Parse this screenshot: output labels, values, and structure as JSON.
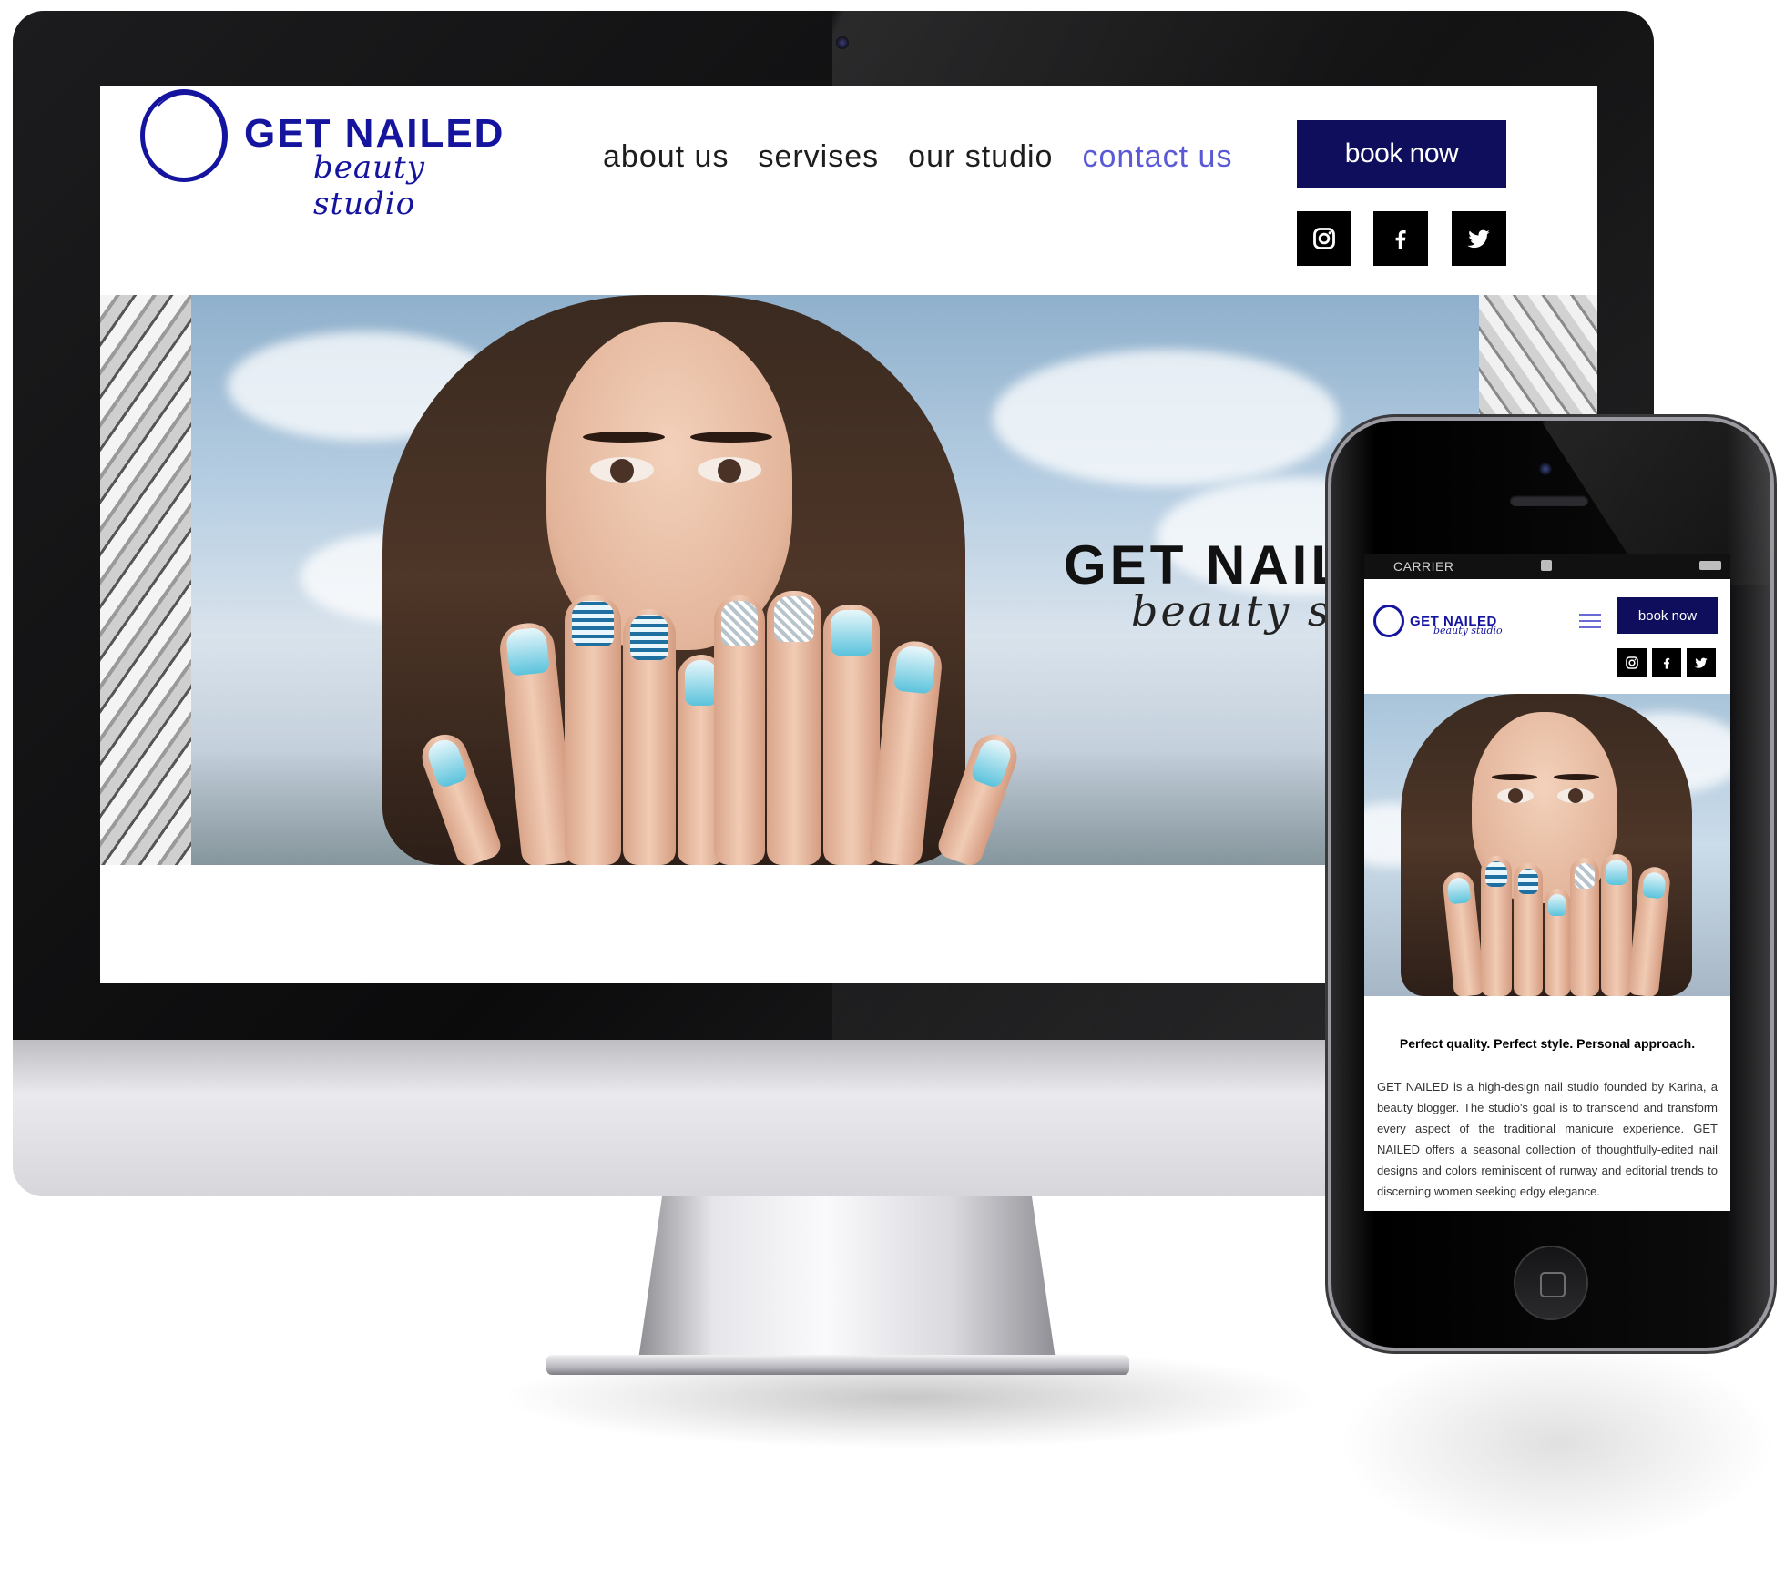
{
  "desktop": {
    "logo": {
      "title": "GET NAILED",
      "subtitle": "beauty studio"
    },
    "nav": {
      "items": [
        {
          "label": "about us",
          "active": false
        },
        {
          "label": "servises",
          "active": false
        },
        {
          "label": "our studio",
          "active": false
        },
        {
          "label": "contact us",
          "active": true
        }
      ]
    },
    "book_button": "book now",
    "social": [
      "instagram-icon",
      "facebook-icon",
      "twitter-icon"
    ],
    "hero": {
      "title": "GET NAIL",
      "subtitle": "beauty stu"
    }
  },
  "mobile": {
    "status_bar": {
      "carrier": "CARRIER"
    },
    "logo": {
      "title": "GET NAILED",
      "subtitle": "beauty studio"
    },
    "book_button": "book now",
    "social": [
      "instagram-icon",
      "facebook-icon",
      "twitter-icon"
    ],
    "tagline": "Perfect quality. Perfect style. Personal approach.",
    "description": "GET NAILED is a high-design nail studio founded by Karina, a beauty blogger. The studio's goal is to transcend and transform every aspect of the traditional manicure experience. GET NAILED offers a seasonal collection of thoughtfully-edited nail designs and colors reminiscent of runway and editorial trends to discerning women seeking edgy elegance."
  },
  "colors": {
    "brand_blue": "#14149e",
    "button_navy": "#0e0e5c",
    "nav_active": "#5a5ad6",
    "nail_teal": "#5bc3dc"
  }
}
